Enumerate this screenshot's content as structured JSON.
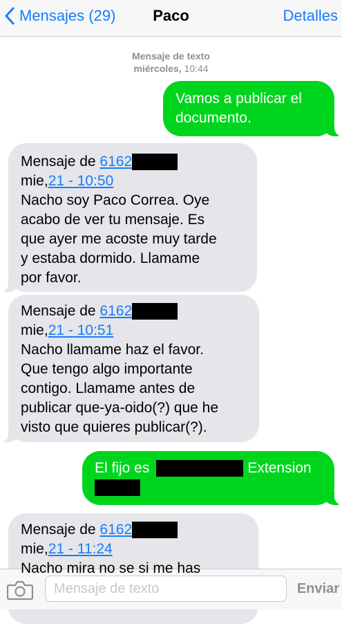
{
  "navbar": {
    "back_label": "Mensajes (29)",
    "title": "Paco",
    "details_label": "Detalles"
  },
  "timestamp": {
    "line1": "Mensaje de texto",
    "day": "miércoles,",
    "time": "10:44"
  },
  "messages": [
    {
      "direction": "sent",
      "lines": [
        "Vamos a publicar el",
        "documento."
      ]
    },
    {
      "direction": "received",
      "header_prefix": "Mensaje de ",
      "phone_link": "6162",
      "date_prefix": "mie,",
      "date_link": "21 - 10:50",
      "lines": [
        "Nacho soy Paco Correa. Oye",
        "acabo de ver tu mensaje. Es",
        "que ayer me acoste muy tarde",
        "y estaba dormido. Llamame",
        "por favor."
      ]
    },
    {
      "direction": "received",
      "header_prefix": "Mensaje de ",
      "phone_link": "6162",
      "date_prefix": "mie,",
      "date_link": "21 - 10:51",
      "lines": [
        "Nacho llamame haz el favor.",
        "Que tengo algo importante",
        "contigo. Llamame antes de",
        "publicar que-ya-oido(?) que he",
        "visto que quieres publicar(?)."
      ]
    },
    {
      "direction": "sent",
      "prefix": "El fijo es",
      "suffix": "Extension"
    },
    {
      "direction": "received",
      "header_prefix": "Mensaje de ",
      "phone_link": "6162",
      "date_prefix": "mie,",
      "date_link": "21 - 11:24",
      "lines": [
        "Nacho mira no se si me has"
      ]
    }
  ],
  "input": {
    "placeholder": "Mensaje de texto",
    "send_label": "Enviar"
  },
  "colors": {
    "accent": "#147efb",
    "sent_bubble": "#00d51d",
    "received_bubble": "#e5e5ea"
  },
  "icons": [
    "chevron-left-icon",
    "camera-icon"
  ]
}
